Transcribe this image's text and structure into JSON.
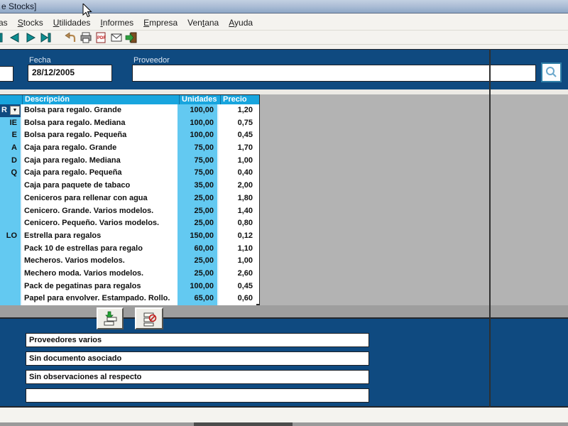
{
  "window": {
    "title_visible": "e Stocks]"
  },
  "menubar": {
    "items": [
      {
        "pre": "as",
        "key": "",
        "post": ""
      },
      {
        "pre": "",
        "key": "S",
        "post": "tocks"
      },
      {
        "pre": "",
        "key": "U",
        "post": "tilidades"
      },
      {
        "pre": "",
        "key": "I",
        "post": "nformes"
      },
      {
        "pre": "",
        "key": "E",
        "post": "mpresa"
      },
      {
        "pre": "Ven",
        "key": "t",
        "post": "ana"
      },
      {
        "pre": "",
        "key": "A",
        "post": "yuda"
      }
    ]
  },
  "toolbar": {
    "icons": [
      "first-record-icon",
      "previous-record-icon",
      "next-record-icon",
      "last-record-icon",
      "undo-icon",
      "print-icon",
      "pdf-export-icon",
      "email-icon",
      "exit-icon"
    ]
  },
  "form": {
    "fecha_label": "Fecha",
    "fecha_value": "28/12/2005",
    "proveedor_label": "Proveedor",
    "proveedor_value": "",
    "search_icon": "magnifier-icon"
  },
  "table": {
    "headers": {
      "code": "",
      "desc": "Descripción",
      "units": "Unidades",
      "price": "Precio"
    },
    "selected_row": 0,
    "rows": [
      {
        "code": "R",
        "desc": "Bolsa para regalo. Grande",
        "units": "100,00",
        "price": "1,20"
      },
      {
        "code": "IE",
        "desc": "Bolsa para regalo. Mediana",
        "units": "100,00",
        "price": "0,75"
      },
      {
        "code": "E",
        "desc": "Bolsa para regalo. Pequeña",
        "units": "100,00",
        "price": "0,45"
      },
      {
        "code": "A",
        "desc": "Caja para regalo. Grande",
        "units": "75,00",
        "price": "1,70"
      },
      {
        "code": "D",
        "desc": "Caja para regalo. Mediana",
        "units": "75,00",
        "price": "1,00"
      },
      {
        "code": "Q",
        "desc": "Caja para regalo. Pequeña",
        "units": "75,00",
        "price": "0,40"
      },
      {
        "code": "",
        "desc": "Caja para paquete de tabaco",
        "units": "35,00",
        "price": "2,00"
      },
      {
        "code": "",
        "desc": "Ceniceros para rellenar con agua",
        "units": "25,00",
        "price": "1,80"
      },
      {
        "code": "",
        "desc": "Cenicero. Grande. Varios modelos.",
        "units": "25,00",
        "price": "1,40"
      },
      {
        "code": "",
        "desc": "Cenicero. Pequeño. Varios modelos.",
        "units": "25,00",
        "price": "0,80"
      },
      {
        "code": "LO",
        "desc": "Estrella para regalos",
        "units": "150,00",
        "price": "0,12"
      },
      {
        "code": "",
        "desc": "Pack 10 de estrellas para regalo",
        "units": "60,00",
        "price": "1,10"
      },
      {
        "code": "",
        "desc": "Mecheros. Varios modelos.",
        "units": "25,00",
        "price": "1,00"
      },
      {
        "code": "",
        "desc": "Mechero moda. Varios modelos.",
        "units": "25,00",
        "price": "2,60"
      },
      {
        "code": "",
        "desc": "Pack de pegatinas para regalos",
        "units": "100,00",
        "price": "0,45"
      },
      {
        "code": "",
        "desc": "Papel para envolver. Estampado. Rollo.",
        "units": "65,00",
        "price": "0,60"
      }
    ]
  },
  "row_buttons": {
    "add": "insert-row-icon",
    "delete": "delete-row-icon"
  },
  "footer": {
    "fields": [
      {
        "value": "Proveedores varios"
      },
      {
        "value": "Sin documento asociado"
      },
      {
        "value": "Sin observaciones al respecto"
      },
      {
        "value": ""
      }
    ]
  },
  "colors": {
    "panel_blue": "#0f4a80",
    "header_blue": "#18a5de",
    "cell_cyan": "#63c9f1",
    "nav_teal": "#0e8f92",
    "search_border": "#2e7ea6"
  }
}
